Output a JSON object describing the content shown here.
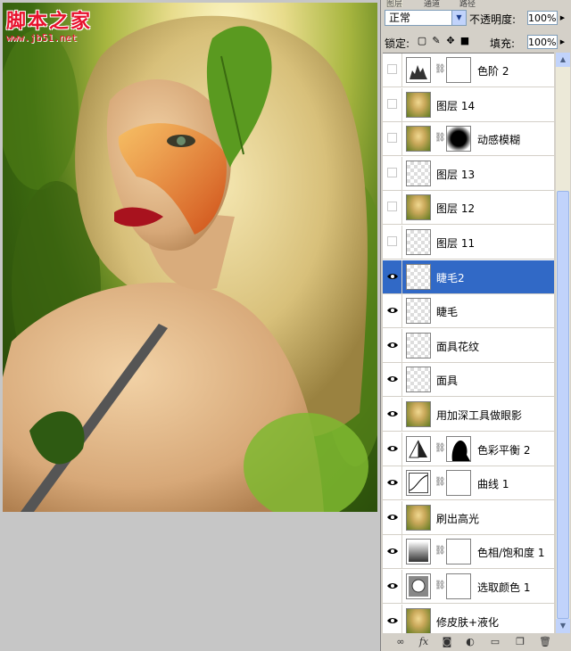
{
  "watermark": {
    "title": "脚本之家",
    "url": "www.jb51.net"
  },
  "panel": {
    "tabs": [
      "图层",
      "通道",
      "路径"
    ],
    "blend_mode": "正常",
    "opacity_label": "不透明度:",
    "opacity_value": "100%",
    "lock_label": "锁定:",
    "fill_label": "填充:",
    "fill_value": "100%"
  },
  "layers": [
    {
      "name": "色阶 2",
      "visible": false,
      "thumb": "levels-adjustment",
      "has_mask": true,
      "selected": false
    },
    {
      "name": "图层 14",
      "visible": false,
      "thumb": "photo",
      "has_mask": false,
      "selected": false
    },
    {
      "name": "动感模糊",
      "visible": false,
      "thumb": "photo",
      "has_mask": true,
      "mask": "black-vignette",
      "selected": false
    },
    {
      "name": "图层 13",
      "visible": false,
      "thumb": "transparent",
      "has_mask": false,
      "selected": false
    },
    {
      "name": "图层 12",
      "visible": false,
      "thumb": "photo",
      "has_mask": false,
      "selected": false
    },
    {
      "name": "图层 11",
      "visible": false,
      "thumb": "transparent",
      "has_mask": false,
      "selected": false
    },
    {
      "name": "睫毛2",
      "visible": true,
      "thumb": "transparent",
      "has_mask": false,
      "selected": true
    },
    {
      "name": "睫毛",
      "visible": true,
      "thumb": "transparent",
      "has_mask": false,
      "selected": false
    },
    {
      "name": "面具花纹",
      "visible": true,
      "thumb": "transparent",
      "has_mask": false,
      "selected": false
    },
    {
      "name": "面具",
      "visible": true,
      "thumb": "transparent",
      "has_mask": false,
      "selected": false
    },
    {
      "name": "用加深工具做眼影",
      "visible": true,
      "thumb": "photo",
      "has_mask": false,
      "selected": false
    },
    {
      "name": "色彩平衡 2",
      "visible": true,
      "thumb": "color-balance-adjustment",
      "has_mask": true,
      "mask": "black-silhouette",
      "selected": false
    },
    {
      "name": "曲线 1",
      "visible": true,
      "thumb": "curves-adjustment",
      "has_mask": true,
      "selected": false
    },
    {
      "name": "刷出高光",
      "visible": true,
      "thumb": "photo",
      "has_mask": false,
      "selected": false
    },
    {
      "name": "色相/饱和度 1",
      "visible": true,
      "thumb": "hue-saturation-adjustment",
      "has_mask": true,
      "selected": false
    },
    {
      "name": "选取颜色 1",
      "visible": true,
      "thumb": "selective-color-adjustment",
      "has_mask": true,
      "selected": false
    },
    {
      "name": "修皮肤+液化",
      "visible": true,
      "thumb": "photo",
      "has_mask": false,
      "selected": false
    }
  ],
  "bottom_icons": [
    "link-layers-icon",
    "fx-icon",
    "add-mask-icon",
    "new-adjustment-icon",
    "new-group-icon",
    "new-layer-icon",
    "trash-icon"
  ],
  "colors": {
    "selection": "#3169c6",
    "panel_bg": "#d4d0c8",
    "watermark": "#e8112d"
  }
}
